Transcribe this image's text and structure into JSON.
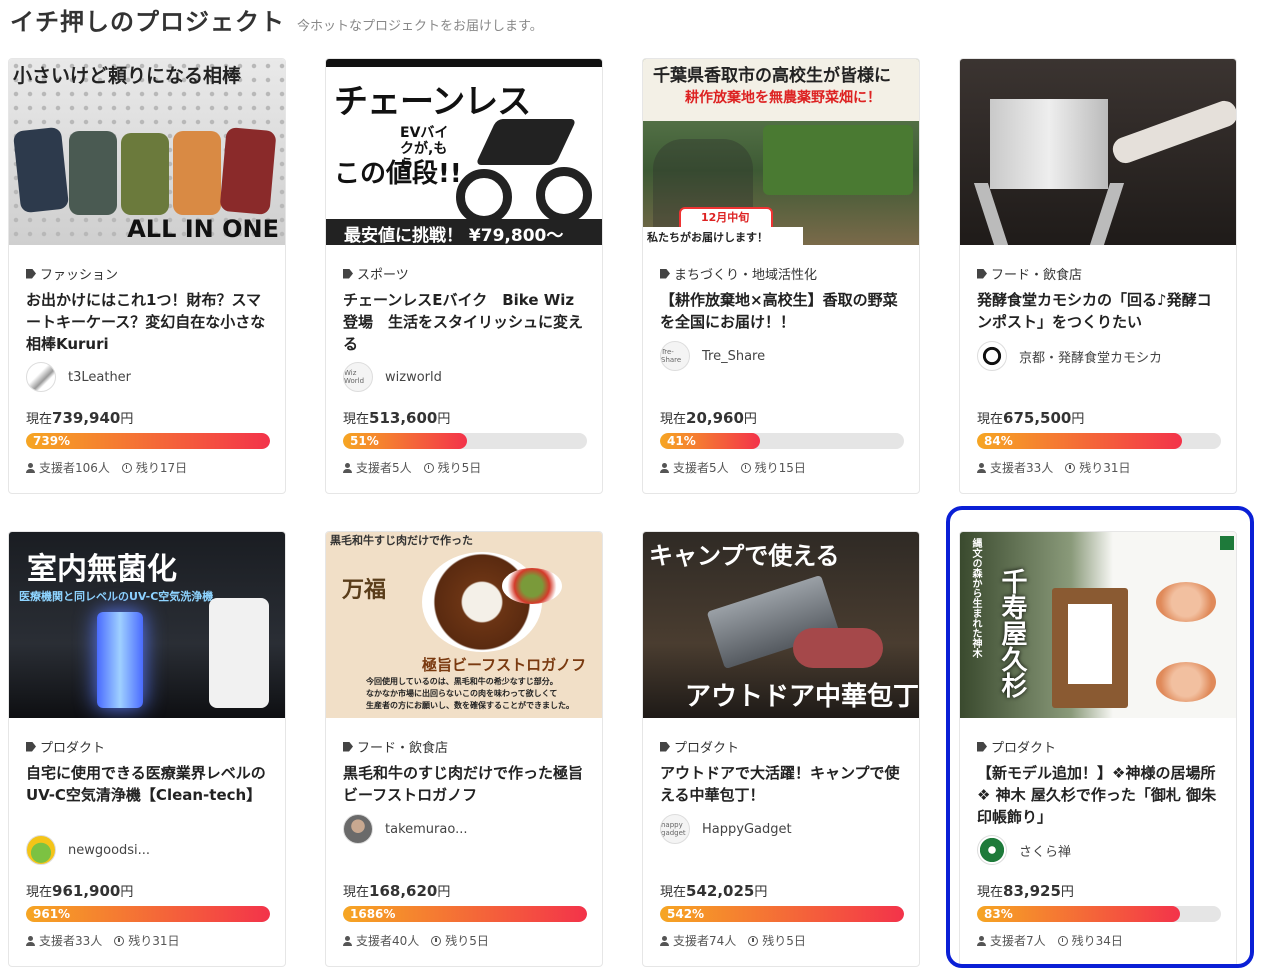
{
  "section": {
    "title": "イチ押しのプロジェクト",
    "subtitle": "今ホットなプロジェクトをお届けします。"
  },
  "projects": [
    {
      "image_text": [
        "小さいけど頼りになる相棒",
        "ALL IN ONE"
      ],
      "category": "ファッション",
      "title": "お出かけにはこれ1つ！財布？スマートキーケース？変幻自在な小さな相棒Kururi",
      "owner": "t3Leather",
      "amount_prefix": "現在",
      "amount": "739,940",
      "amount_unit": "円",
      "progress_label": "739%",
      "progress_fraction": 1.0,
      "supporters": "支援者106人",
      "remaining": "残り17日",
      "avatar_text": ""
    },
    {
      "image_text": [
        "チェーンレス",
        "EVバイクが,もう",
        "この値段!!",
        "最安値に挑戦！ ¥79,800〜"
      ],
      "category": "スポーツ",
      "title": "チェーンレスEバイク　Bike Wiz 登場　生活をスタイリッシュに変える",
      "owner": "wizworld",
      "amount_prefix": "現在",
      "amount": "513,600",
      "amount_unit": "円",
      "progress_label": "51%",
      "progress_fraction": 0.51,
      "supporters": "支援者5人",
      "remaining": "残り5日",
      "avatar_text": "Wiz World"
    },
    {
      "image_text": [
        "千葉県香取市の高校生が皆様に",
        "耕作放棄地を無農薬野菜畑に！",
        "12月中旬",
        "私たちがお届けします！"
      ],
      "category": "まちづくり・地域活性化",
      "title": "【耕作放棄地×高校生】香取の野菜を全国にお届け！！",
      "owner": "Tre_Share",
      "amount_prefix": "現在",
      "amount": "20,960",
      "amount_unit": "円",
      "progress_label": "41%",
      "progress_fraction": 0.41,
      "supporters": "支援者5人",
      "remaining": "残り15日",
      "avatar_text": "Tre-Share"
    },
    {
      "image_text": [],
      "category": "フード・飲食店",
      "title": "発酵食堂カモシカの「回る♪発酵コンポスト」をつくりたい",
      "owner": "京都・発酵食堂カモシカ",
      "amount_prefix": "現在",
      "amount": "675,500",
      "amount_unit": "円",
      "progress_label": "84%",
      "progress_fraction": 0.84,
      "supporters": "支援者33人",
      "remaining": "残り31日",
      "avatar_text": ""
    },
    {
      "image_text": [
        "室内無菌化",
        "医療機関と同レベルのUV-C空気洗浄機"
      ],
      "category": "プロダクト",
      "title": "自宅に使用できる医療業界レベルのUV-C空気清浄機【Clean-tech】",
      "owner": "newgoodsi...",
      "amount_prefix": "現在",
      "amount": "961,900",
      "amount_unit": "円",
      "progress_label": "961%",
      "progress_fraction": 1.0,
      "supporters": "支援者33人",
      "remaining": "残り31日",
      "avatar_text": ""
    },
    {
      "image_text": [
        "黒毛和牛すじ肉だけで作った",
        "万福",
        "極旨ビーフストロガノフ",
        "今回使用しているのは、黒毛和牛の希少なすじ部分。",
        "なかなか市場に出回らないこの肉を味わって欲しくて",
        "生産者の方にお願いし、数を確保することができました。"
      ],
      "category": "フード・飲食店",
      "title": "黒毛和牛のすじ肉だけで作った極旨ビーフストロガノフ",
      "owner": "takemurao...",
      "amount_prefix": "現在",
      "amount": "168,620",
      "amount_unit": "円",
      "progress_label": "1686%",
      "progress_fraction": 1.0,
      "supporters": "支援者40人",
      "remaining": "残り5日",
      "avatar_text": ""
    },
    {
      "image_text": [
        "キャンプで使える",
        "アウトドア中華包丁"
      ],
      "category": "プロダクト",
      "title": "アウトドアで大活躍！キャンプで使える中華包丁！",
      "owner": "HappyGadget",
      "amount_prefix": "現在",
      "amount": "542,025",
      "amount_unit": "円",
      "progress_label": "542%",
      "progress_fraction": 1.0,
      "supporters": "支援者74人",
      "remaining": "残り5日",
      "avatar_text": "happy gadget"
    },
    {
      "image_text": [
        "千寿屋久杉",
        "縄文の森から生まれた神木"
      ],
      "category": "プロダクト",
      "title": "【新モデル追加！】❖神様の居場所❖ 神木 屋久杉で作った「御札 御朱印帳飾り」",
      "owner": "さくら禅",
      "amount_prefix": "現在",
      "amount": "83,925",
      "amount_unit": "円",
      "progress_label": "83%",
      "progress_fraction": 0.83,
      "supporters": "支援者7人",
      "remaining": "残り34日",
      "avatar_text": ""
    }
  ],
  "colors": {
    "highlight": "#0a1fd6",
    "bar_start": "#f6a623",
    "bar_end": "#f3334a"
  }
}
